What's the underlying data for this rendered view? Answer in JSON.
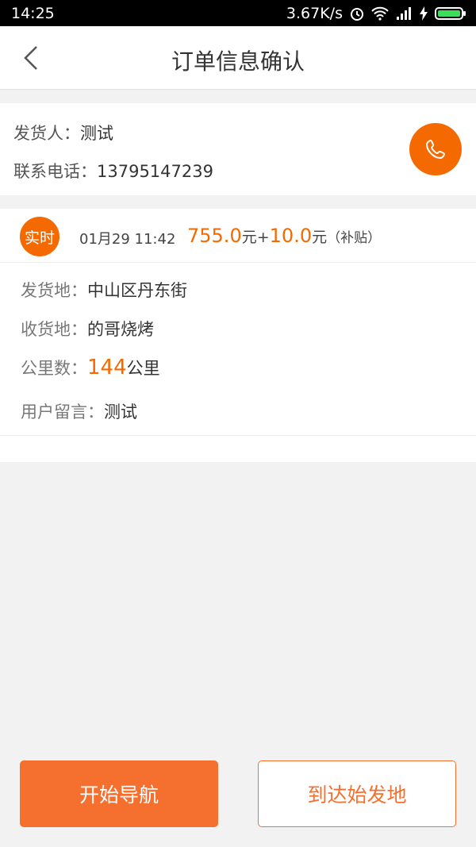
{
  "status_bar": {
    "time": "14:25",
    "speed": "3.67K/s"
  },
  "header": {
    "title": "订单信息确认"
  },
  "sender": {
    "name_label": "发货人：",
    "name_value": "测试",
    "phone_label": "联系电话：",
    "phone_value": "13795147239"
  },
  "order": {
    "badge": "实时",
    "datetime": "01月29 11:42",
    "price": "755.0",
    "unit1": "元",
    "plus": "+",
    "subsidy": "10.0",
    "unit2": "元",
    "subsidy_note": "（补贴）",
    "origin_label": "发货地：",
    "origin_value": "中山区丹东街",
    "dest_label": "收货地：",
    "dest_value": "的哥烧烤",
    "distance_label": "公里数：",
    "distance_value": "144",
    "distance_unit": "公里",
    "note_label": "用户留言：",
    "note_value": "测试"
  },
  "actions": {
    "start_nav": "开始导航",
    "arrive": "到达始发地"
  },
  "colors": {
    "accent": "#f56a00",
    "button": "#f56f2f"
  }
}
